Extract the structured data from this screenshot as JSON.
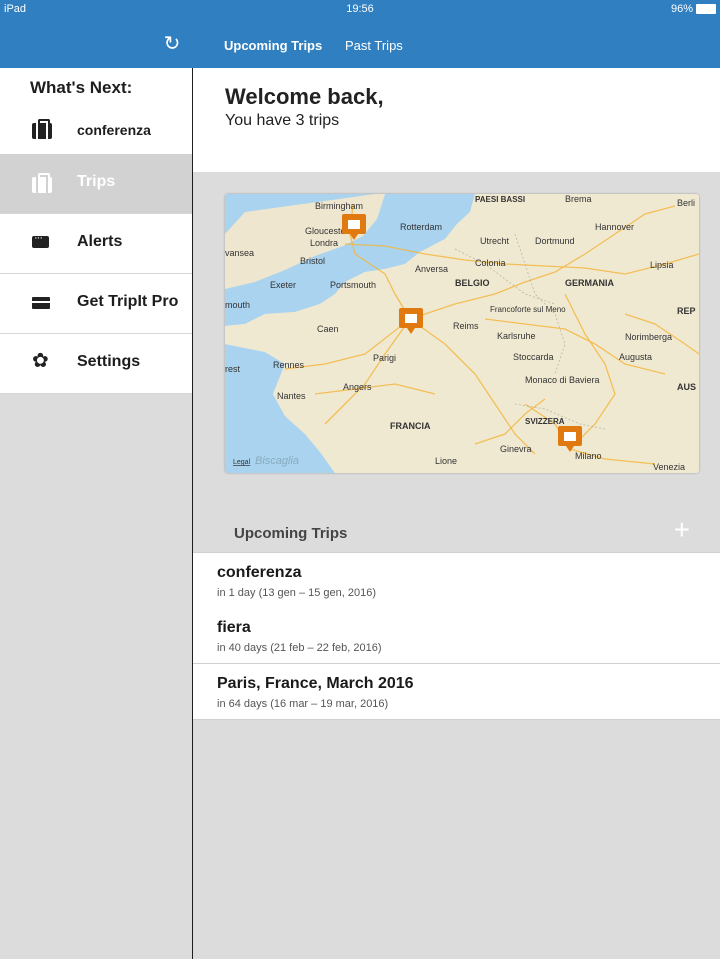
{
  "status_bar": {
    "device": "iPad",
    "time": "19:56",
    "battery": "96%"
  },
  "nav": {
    "tabs": [
      {
        "label": "Upcoming Trips",
        "active": true
      },
      {
        "label": "Past Trips",
        "active": false
      }
    ],
    "refresh_icon": "refresh-icon"
  },
  "sidebar": {
    "whats_next_title": "What's Next:",
    "next_trip": "conferenza",
    "items": [
      {
        "label": "Trips",
        "icon": "suitcase-icon",
        "active": true
      },
      {
        "label": "Alerts",
        "icon": "chat-bubble-icon",
        "active": false
      },
      {
        "label": "Get TripIt Pro",
        "icon": "credit-card-icon",
        "active": false
      },
      {
        "label": "Settings",
        "icon": "gear-icon",
        "active": false
      }
    ]
  },
  "main": {
    "welcome_title": "Welcome back,",
    "trip_count_text": "You have 3 trips",
    "map": {
      "cities": [
        "Birmingham",
        "Gloucester",
        "Londra",
        "Bristol",
        "Exeter",
        "Portsmouth",
        "Rotterdam",
        "Utrecht",
        "PAESI BASSI",
        "Brema",
        "Hannover",
        "Dortmund",
        "Colonia",
        "Anversa",
        "BELGIO",
        "GERMANIA",
        "Lipsia",
        "Francoforte sul Meno",
        "Karlsruhe",
        "Reims",
        "Caen",
        "Parigi",
        "Rennes",
        "Nantes",
        "Angers",
        "Stoccarda",
        "Augusta",
        "Norimberga",
        "Monaco di Baviera",
        "FRANCIA",
        "SVIZZERA",
        "Ginevra",
        "Milano",
        "Lione",
        "Biscaglia",
        "Berli",
        "REP",
        "AUS",
        "Venezia",
        "vansea",
        "mouth",
        "rest"
      ],
      "legal": "Legal"
    },
    "section_title": "Upcoming Trips",
    "add_icon": "plus-icon",
    "trips": [
      {
        "name": "conferenza",
        "detail": "in 1 day (13 gen – 15 gen, 2016)"
      },
      {
        "name": "fiera",
        "detail": "in 40 days (21 feb – 22 feb, 2016)"
      },
      {
        "name": "Paris, France, March 2016",
        "detail": "in 64 days (16 mar – 19 mar, 2016)"
      }
    ]
  },
  "colors": {
    "nav_blue": "#2f7fc1",
    "pin_orange": "#e07a10",
    "background_gray": "#dcdcdc"
  }
}
